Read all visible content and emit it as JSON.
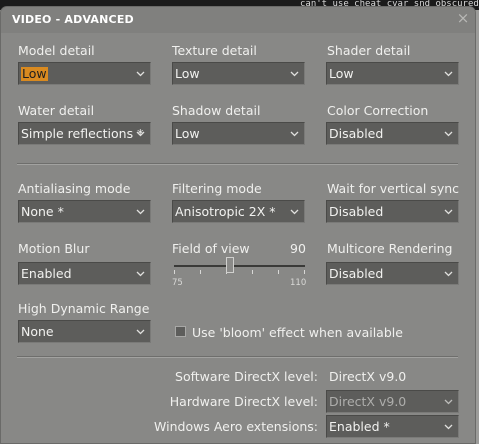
{
  "background": {
    "console_text": "can't use cheat cvar snd_obscured_gain_db in multiplay"
  },
  "dialog": {
    "title": "VIDEO - ADVANCED",
    "close_glyph": "×"
  },
  "settings": {
    "model_detail": {
      "label": "Model detail",
      "value": "Low"
    },
    "texture_detail": {
      "label": "Texture detail",
      "value": "Low"
    },
    "shader_detail": {
      "label": "Shader detail",
      "value": "Low"
    },
    "water_detail": {
      "label": "Water detail",
      "value": "Simple reflections *"
    },
    "shadow_detail": {
      "label": "Shadow detail",
      "value": "Low"
    },
    "color_correction": {
      "label": "Color Correction",
      "value": "Disabled"
    },
    "antialiasing_mode": {
      "label": "Antialiasing mode",
      "value": "None *"
    },
    "filtering_mode": {
      "label": "Filtering mode",
      "value": "Anisotropic 2X *"
    },
    "vsync": {
      "label": "Wait for vertical sync",
      "value": "Disabled"
    },
    "motion_blur": {
      "label": "Motion Blur",
      "value": "Enabled"
    },
    "multicore": {
      "label": "Multicore Rendering",
      "value": "Disabled"
    },
    "hdr": {
      "label": "High Dynamic Range",
      "value": "None"
    }
  },
  "field_of_view": {
    "label": "Field of view",
    "value": "90",
    "min_label": "75",
    "max_label": "110",
    "min": 75,
    "max": 110,
    "current": 90
  },
  "bloom": {
    "label": "Use 'bloom' effect when available",
    "checked": false
  },
  "directx": {
    "software_label": "Software DirectX level:",
    "software_value": "DirectX v9.0",
    "hardware_label": "Hardware DirectX level:",
    "hardware_value": "DirectX v9.0",
    "aero_label": "Windows Aero extensions:",
    "aero_value": "Enabled *"
  },
  "colors": {
    "selected_highlight": "#d98a20",
    "panel": "#888886",
    "field": "#5d5d5b"
  },
  "icons": {
    "dropdown": "chevron-down-icon",
    "close": "close-icon"
  }
}
